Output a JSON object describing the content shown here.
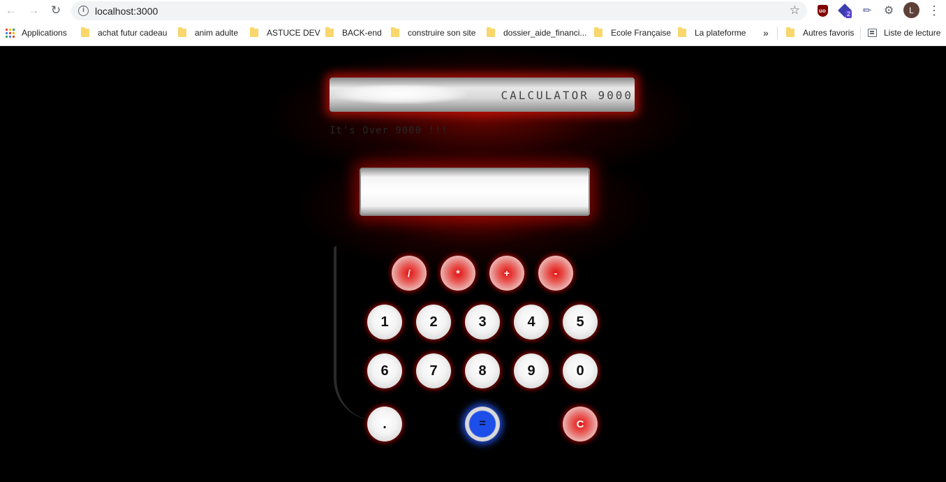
{
  "browser": {
    "url": "localhost:3000",
    "avatar_letter": "L",
    "extension_badge": "2",
    "ublock_label": "uo",
    "bookmarks": [
      {
        "label": "Applications"
      },
      {
        "label": "achat futur cadeau"
      },
      {
        "label": "anim adulte"
      },
      {
        "label": "ASTUCE DEV"
      },
      {
        "label": "BACK-end"
      },
      {
        "label": "construire son site"
      },
      {
        "label": "dossier_aide_financi..."
      },
      {
        "label": "Ecole Française"
      },
      {
        "label": "La plateforme"
      },
      {
        "label": "»"
      },
      {
        "label": "Autres favoris"
      },
      {
        "label": "Liste de lecture"
      }
    ]
  },
  "calculator": {
    "title": "CALCULATOR 9000",
    "subtitle": "It's Over 9000 !!!",
    "display_value": "",
    "operators": [
      "/",
      "*",
      "+",
      "-"
    ],
    "digits_row1": [
      "1",
      "2",
      "3",
      "4",
      "5"
    ],
    "digits_row2": [
      "6",
      "7",
      "8",
      "9",
      "0"
    ],
    "decimal": ".",
    "equals": "=",
    "clear": "C"
  },
  "colors": {
    "glow": "#c80a00",
    "equals_accent": "#1d4fe8",
    "page_background": "#000000"
  }
}
